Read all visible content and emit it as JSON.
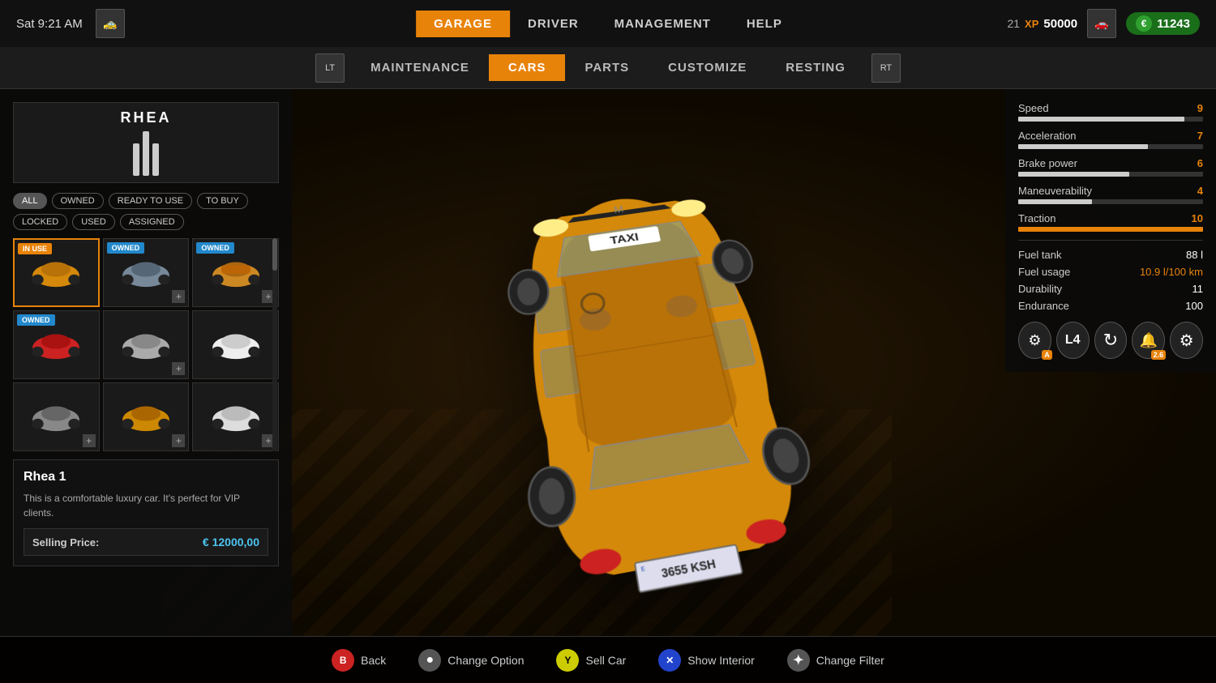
{
  "topbar": {
    "time": "Sat  9:21 AM",
    "nav_items": [
      {
        "label": "GARAGE",
        "active": true
      },
      {
        "label": "DRIVER",
        "active": false
      },
      {
        "label": "MANAGEMENT",
        "active": false
      },
      {
        "label": "HELP",
        "active": false
      }
    ],
    "xp_level": "21",
    "xp_label": "XP",
    "xp_points": "50000",
    "currency": "11243",
    "currency_symbol": "€"
  },
  "second_nav": {
    "items": [
      {
        "label": "MAINTENANCE",
        "active": false
      },
      {
        "label": "CARS",
        "active": true
      },
      {
        "label": "PARTS",
        "active": false
      },
      {
        "label": "CUSTOMIZE",
        "active": false
      },
      {
        "label": "RESTING",
        "active": false
      }
    ]
  },
  "brand": {
    "name": "RHEA"
  },
  "filter_tags": [
    {
      "label": "ALL",
      "active": true
    },
    {
      "label": "OWNED",
      "active": false
    },
    {
      "label": "READY TO USE",
      "active": false
    },
    {
      "label": "TO BUY",
      "active": false
    },
    {
      "label": "LOCKED",
      "active": false
    },
    {
      "label": "USED",
      "active": false
    },
    {
      "label": "ASSIGNED",
      "active": false
    }
  ],
  "car_grid": [
    {
      "badge": "IN USE",
      "badge_type": "inuse",
      "selected": true,
      "has_plus": false
    },
    {
      "badge": "OWNED",
      "badge_type": "owned",
      "selected": false,
      "has_plus": true
    },
    {
      "badge": "OWNED",
      "badge_type": "owned",
      "selected": false,
      "has_plus": true
    },
    {
      "badge": "OWNED",
      "badge_type": "owned",
      "selected": false,
      "has_plus": false
    },
    {
      "badge": "",
      "badge_type": "",
      "selected": false,
      "has_plus": true
    },
    {
      "badge": "",
      "badge_type": "",
      "selected": false,
      "has_plus": false
    },
    {
      "badge": "",
      "badge_type": "",
      "selected": false,
      "has_plus": true
    },
    {
      "badge": "",
      "badge_type": "",
      "selected": false,
      "has_plus": true
    },
    {
      "badge": "",
      "badge_type": "",
      "selected": false,
      "has_plus": true
    }
  ],
  "car_info": {
    "name": "Rhea 1",
    "description": "This is a comfortable luxury car. It's perfect for VIP clients.",
    "price_label": "Selling Price:",
    "price_value": "€ 12000,00"
  },
  "stats": {
    "bars": [
      {
        "label": "Speed",
        "value": 9,
        "max": 10,
        "pct": 90
      },
      {
        "label": "Acceleration",
        "value": 7,
        "max": 10,
        "pct": 70
      },
      {
        "label": "Brake power",
        "value": 6,
        "max": 10,
        "pct": 60
      },
      {
        "label": "Maneuverability",
        "value": 4,
        "max": 10,
        "pct": 40
      },
      {
        "label": "Traction",
        "value": 10,
        "max": 10,
        "pct": 100
      }
    ],
    "text_stats": [
      {
        "label": "Fuel tank",
        "value": "88 l",
        "orange": false
      },
      {
        "label": "Fuel usage",
        "value": "10.9 l/100 km",
        "orange": true
      },
      {
        "label": "Durability",
        "value": "11",
        "orange": false
      },
      {
        "label": "Endurance",
        "value": "100",
        "orange": false
      }
    ],
    "badges": [
      {
        "icon": "⚙",
        "label": "A"
      },
      {
        "icon": "4",
        "label": "L"
      },
      {
        "icon": "↻",
        "label": ""
      },
      {
        "icon": "🔔",
        "label": "2.6"
      },
      {
        "icon": "⚙",
        "label": ""
      }
    ]
  },
  "bottom_actions": [
    {
      "btn_label": "B",
      "btn_type": "btn-b",
      "action_label": "Back"
    },
    {
      "btn_label": "●",
      "btn_type": "btn-lb",
      "action_label": "Change Option"
    },
    {
      "btn_label": "Y",
      "btn_type": "btn-y",
      "action_label": "Sell Car"
    },
    {
      "btn_label": "✕",
      "btn_type": "btn-x",
      "action_label": "Show Interior"
    },
    {
      "btn_label": "✦",
      "btn_type": "btn-dpad",
      "action_label": "Change Filter"
    }
  ],
  "license_plate": "3655 KSH"
}
